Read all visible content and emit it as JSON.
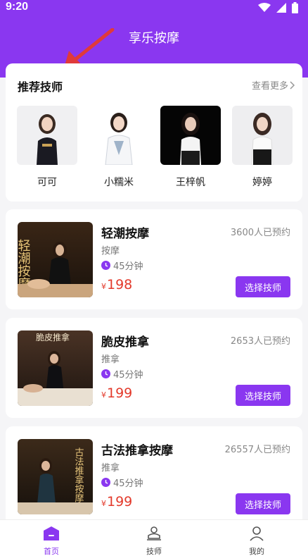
{
  "status": {
    "time": "9:20"
  },
  "header": {
    "title": "享乐按摩"
  },
  "recommend": {
    "title": "推荐技师",
    "more": "查看更多",
    "techs": [
      {
        "name": "可可"
      },
      {
        "name": "小糯米"
      },
      {
        "name": "王梓帆"
      },
      {
        "name": "婷婷"
      }
    ]
  },
  "services": [
    {
      "name": "轻潮按摩",
      "booked": "3600人已预约",
      "category": "按摩",
      "duration": "45分钟",
      "currency": "¥",
      "price": "198",
      "button": "选择技师",
      "thumb_text": "轻潮按摩"
    },
    {
      "name": "脆皮推拿",
      "booked": "2653人已预约",
      "category": "推拿",
      "duration": "45分钟",
      "currency": "¥",
      "price": "199",
      "button": "选择技师",
      "thumb_text": "脆皮推拿"
    },
    {
      "name": "古法推拿按摩",
      "booked": "26557人已预约",
      "category": "推拿",
      "duration": "45分钟",
      "currency": "¥",
      "price": "199",
      "button": "选择技师",
      "thumb_text": "古法推拿按摩"
    }
  ],
  "tabbar": [
    {
      "label": "首页",
      "icon": "home-icon"
    },
    {
      "label": "技师",
      "icon": "technician-icon"
    },
    {
      "label": "我的",
      "icon": "profile-icon"
    }
  ],
  "colors": {
    "accent": "#8a37f0",
    "price": "#e33a2b"
  }
}
